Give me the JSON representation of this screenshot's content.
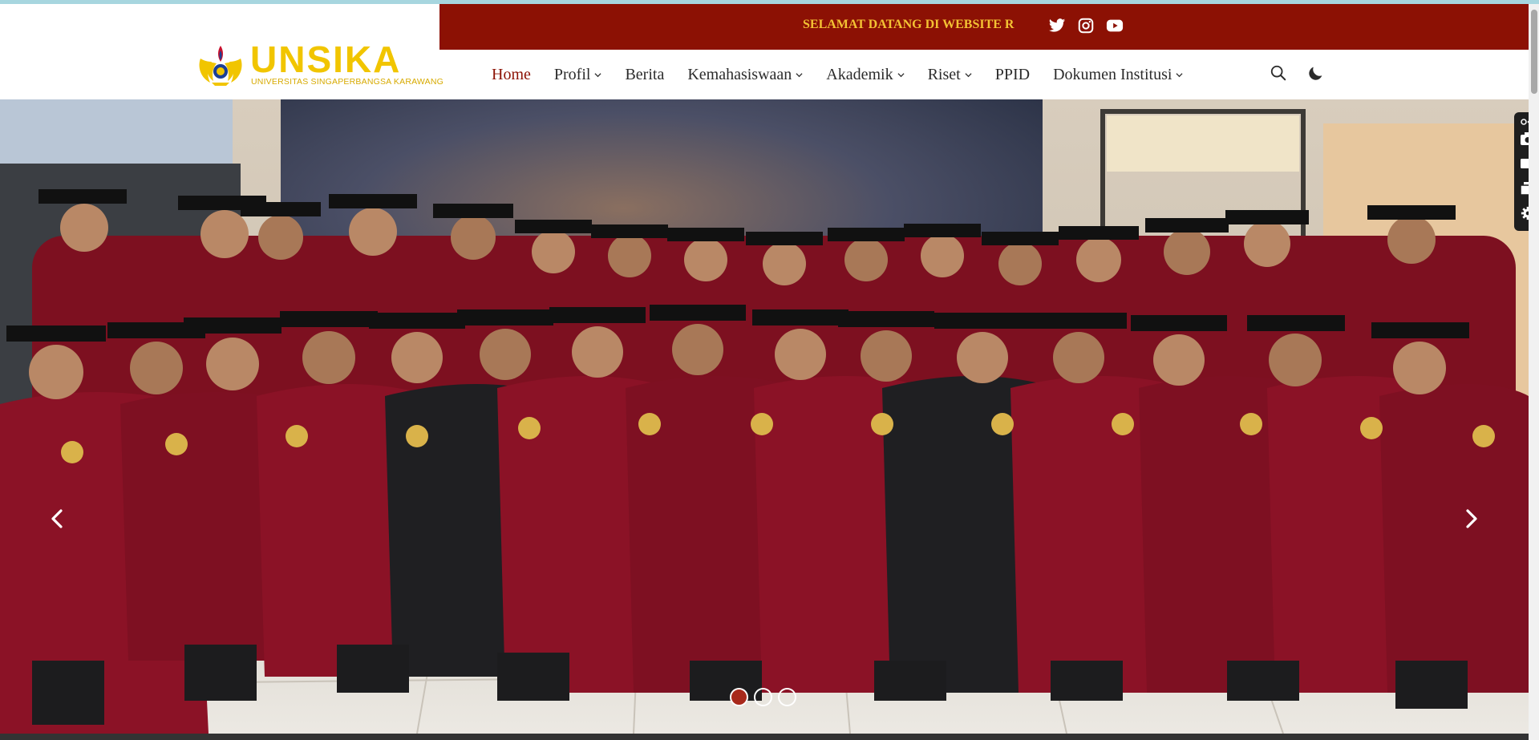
{
  "brand": {
    "name": "UNSIKA",
    "subtitle": "UNIVERSITAS SINGAPERBANGSA KARAWANG",
    "colors": {
      "primary": "#8c1104",
      "gold": "#f1c500",
      "marquee_text": "#f3c233"
    }
  },
  "topbar": {
    "marquee_text": "SELAMAT DATANG DI WEBSITE R",
    "social_icons": [
      "twitter-icon",
      "instagram-icon",
      "youtube-icon"
    ]
  },
  "nav": {
    "items": [
      {
        "label": "Home",
        "active": true,
        "dropdown": false
      },
      {
        "label": "Profil",
        "active": false,
        "dropdown": true
      },
      {
        "label": "Berita",
        "active": false,
        "dropdown": false
      },
      {
        "label": "Kemahasiswaan",
        "active": false,
        "dropdown": true
      },
      {
        "label": "Akademik",
        "active": false,
        "dropdown": true
      },
      {
        "label": "Riset",
        "active": false,
        "dropdown": true
      },
      {
        "label": "PPID",
        "active": false,
        "dropdown": false
      },
      {
        "label": "Dokumen Institusi",
        "active": false,
        "dropdown": true
      }
    ],
    "tools": [
      "search-icon",
      "moon-icon"
    ]
  },
  "hero": {
    "slide_count": 3,
    "active_slide": 1,
    "controls": [
      "chevron-left-icon",
      "chevron-right-icon"
    ]
  },
  "side_widget": {
    "icons": [
      "link-icon",
      "camera-icon",
      "video-icon",
      "copy-icon",
      "gear-icon"
    ]
  }
}
